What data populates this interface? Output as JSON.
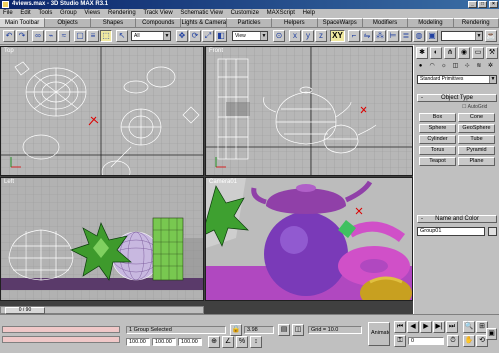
{
  "window": {
    "title": "4views.max - 3D Studio MAX R3.1",
    "min": "_",
    "max": "□",
    "close": "×"
  },
  "menu": [
    "File",
    "Edit",
    "Tools",
    "Group",
    "Views",
    "Rendering",
    "Track View",
    "Schematic View",
    "Customize",
    "MAXScript",
    "Help"
  ],
  "tabs": [
    "Main Toolbar",
    "Objects",
    "Shapes",
    "Compounds",
    "Lights & Cameras",
    "Particles",
    "Helpers",
    "SpaceWarps",
    "Modifiers",
    "Modeling",
    "Rendering"
  ],
  "toolbar": {
    "selection_filter": "All",
    "ref_coord": "View",
    "axis_xy": "XY",
    "dropdown_arrow": "▼"
  },
  "viewports": {
    "top": {
      "label": "Top"
    },
    "front": {
      "label": "Front"
    },
    "left": {
      "label": "Left"
    },
    "camera": {
      "label": "Camera01"
    }
  },
  "timeslider": {
    "label": "0 / 90"
  },
  "command_panel": {
    "category_dropdown": "Standard Primitives",
    "rollout_object_type": "Object Type",
    "rollout_sign": "-",
    "autogrid": "AutoGrid",
    "buttons": [
      "Box",
      "Cone",
      "Sphere",
      "GeoSphere",
      "Cylinder",
      "Tube",
      "Torus",
      "Pyramid",
      "Teapot",
      "Plane"
    ],
    "rollout_name_color": "Name and Color",
    "object_name": "Group01"
  },
  "status": {
    "selection": "1 Group Selected",
    "x": "100.00",
    "y": "100.00",
    "z": "100.00",
    "lock_value": "3.98",
    "grid": "Grid = 10.0",
    "animate": "Animate",
    "frame": "0"
  },
  "colors": {
    "title_start": "#0a246a",
    "title_end": "#3a6ea5",
    "viewport_bg": "#b7b7b7",
    "status_pink": "#f0c8c8"
  }
}
